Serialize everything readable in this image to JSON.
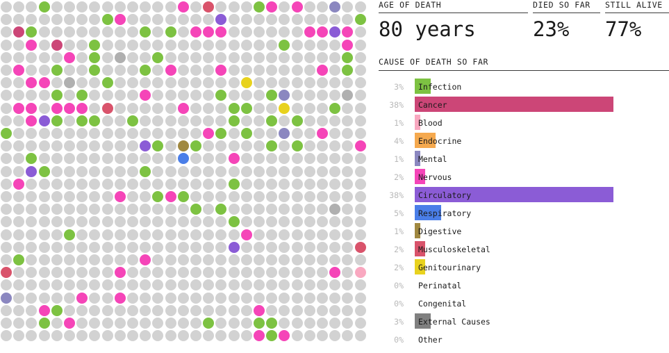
{
  "kpis": [
    {
      "id": "age-of-death",
      "label": "AGE OF DEATH",
      "value": "80 years"
    },
    {
      "id": "died-so-far",
      "label": "DIED SO FAR",
      "value": "23%"
    },
    {
      "id": "still-alive",
      "label": "STILL ALIVE",
      "value": "77%"
    }
  ],
  "cause_section": {
    "title": "CAUSE OF DEATH SO FAR"
  },
  "chart_data": {
    "type": "bar",
    "title": "CAUSE OF DEATH SO FAR",
    "xlabel": "",
    "ylabel": "",
    "orientation": "horizontal",
    "xlim": [
      0,
      100
    ],
    "grid": false,
    "legend": "none",
    "categories": [
      "Infection",
      "Cancer",
      "Blood",
      "Endocrine",
      "Mental",
      "Nervous",
      "Circulatory",
      "Respiratory",
      "Digestive",
      "Musculoskeletal",
      "Genitourinary",
      "Perinatal",
      "Congenital",
      "External Causes",
      "Other"
    ],
    "values": [
      3,
      38,
      1,
      4,
      1,
      2,
      38,
      5,
      1,
      2,
      2,
      0,
      0,
      3,
      0
    ],
    "value_labels": [
      "3%",
      "38%",
      "1%",
      "4%",
      "1%",
      "2%",
      "38%",
      "5%",
      "1%",
      "2%",
      "2%",
      "0%",
      "0%",
      "3%",
      "0%"
    ],
    "colors": [
      "#7DC242",
      "#CC4677",
      "#F9A8C0",
      "#F5A94E",
      "#8B87C0",
      "#F545B8",
      "#8B5CD6",
      "#4A7EE8",
      "#A08840",
      "#D9536B",
      "#E8D21E",
      "#B0B0B0",
      "#B0B0B0",
      "#808080",
      "#B0B0B0"
    ]
  },
  "grid": {
    "columns": 29,
    "rows": 27,
    "pitch": 18.2,
    "dot_size": 16,
    "alive_color": "#D2D2D2",
    "cells": [
      [
        0,
        0,
        0,
        1,
        0,
        0,
        0,
        0,
        0,
        0,
        0,
        0,
        0,
        0,
        6,
        0,
        10,
        0,
        0,
        0,
        1,
        6,
        0,
        6,
        0,
        0,
        5,
        0,
        0
      ],
      [
        0,
        0,
        0,
        0,
        0,
        0,
        0,
        0,
        1,
        6,
        0,
        0,
        0,
        0,
        0,
        0,
        0,
        7,
        0,
        0,
        0,
        0,
        0,
        0,
        0,
        0,
        0,
        0,
        1
      ],
      [
        0,
        2,
        1,
        0,
        0,
        0,
        0,
        0,
        0,
        0,
        0,
        1,
        0,
        1,
        0,
        6,
        6,
        6,
        0,
        0,
        0,
        0,
        0,
        0,
        6,
        6,
        7,
        6,
        0
      ],
      [
        0,
        0,
        6,
        0,
        2,
        0,
        0,
        1,
        0,
        0,
        0,
        0,
        0,
        0,
        0,
        0,
        0,
        0,
        0,
        0,
        0,
        0,
        1,
        0,
        0,
        0,
        0,
        6,
        0
      ],
      [
        0,
        0,
        0,
        0,
        0,
        6,
        0,
        1,
        0,
        13,
        0,
        0,
        1,
        0,
        0,
        0,
        0,
        0,
        0,
        0,
        0,
        0,
        0,
        0,
        0,
        0,
        0,
        1,
        0
      ],
      [
        0,
        6,
        0,
        0,
        1,
        0,
        0,
        1,
        0,
        0,
        0,
        1,
        0,
        6,
        0,
        0,
        0,
        6,
        0,
        0,
        0,
        0,
        0,
        0,
        0,
        6,
        0,
        1,
        0
      ],
      [
        0,
        0,
        6,
        6,
        0,
        13,
        0,
        0,
        1,
        0,
        0,
        0,
        0,
        0,
        0,
        0,
        0,
        0,
        0,
        11,
        0,
        0,
        0,
        0,
        0,
        0,
        0,
        0,
        0
      ],
      [
        0,
        0,
        0,
        0,
        1,
        0,
        1,
        0,
        0,
        0,
        0,
        6,
        0,
        0,
        0,
        0,
        0,
        1,
        0,
        0,
        0,
        1,
        5,
        0,
        0,
        0,
        0,
        13,
        0
      ],
      [
        0,
        6,
        6,
        0,
        6,
        6,
        6,
        0,
        10,
        0,
        0,
        0,
        0,
        0,
        6,
        0,
        0,
        0,
        1,
        1,
        0,
        0,
        11,
        0,
        0,
        0,
        1,
        0,
        0
      ],
      [
        0,
        0,
        6,
        7,
        1,
        0,
        1,
        1,
        0,
        0,
        1,
        0,
        0,
        0,
        0,
        0,
        0,
        0,
        1,
        0,
        0,
        1,
        0,
        1,
        0,
        0,
        0,
        0,
        0
      ],
      [
        1,
        0,
        0,
        0,
        0,
        0,
        0,
        0,
        0,
        0,
        0,
        0,
        0,
        0,
        0,
        0,
        6,
        1,
        0,
        1,
        0,
        0,
        5,
        0,
        0,
        6,
        0,
        0,
        0
      ],
      [
        0,
        0,
        0,
        0,
        0,
        0,
        0,
        0,
        0,
        0,
        0,
        7,
        1,
        0,
        9,
        1,
        0,
        0,
        0,
        0,
        0,
        1,
        0,
        1,
        0,
        0,
        0,
        0,
        6
      ],
      [
        0,
        0,
        1,
        0,
        0,
        0,
        0,
        0,
        0,
        0,
        0,
        0,
        0,
        0,
        8,
        0,
        0,
        0,
        6,
        0,
        0,
        0,
        0,
        0,
        0,
        0,
        0,
        0,
        0
      ],
      [
        0,
        0,
        7,
        1,
        0,
        0,
        0,
        0,
        0,
        0,
        0,
        1,
        0,
        0,
        0,
        0,
        0,
        0,
        0,
        0,
        0,
        0,
        0,
        0,
        0,
        0,
        0,
        0,
        0
      ],
      [
        0,
        6,
        0,
        0,
        0,
        0,
        0,
        0,
        0,
        0,
        0,
        0,
        0,
        0,
        0,
        0,
        0,
        0,
        1,
        0,
        0,
        0,
        0,
        0,
        0,
        0,
        0,
        0,
        0
      ],
      [
        0,
        0,
        0,
        0,
        0,
        0,
        0,
        0,
        0,
        6,
        0,
        0,
        1,
        6,
        1,
        0,
        0,
        0,
        0,
        0,
        0,
        0,
        0,
        0,
        0,
        0,
        0,
        0,
        0
      ],
      [
        0,
        0,
        0,
        0,
        0,
        0,
        0,
        0,
        0,
        0,
        0,
        0,
        0,
        0,
        0,
        1,
        0,
        1,
        0,
        0,
        0,
        0,
        0,
        0,
        0,
        0,
        13,
        0,
        0
      ],
      [
        0,
        0,
        0,
        0,
        0,
        0,
        0,
        0,
        0,
        0,
        0,
        0,
        0,
        0,
        0,
        0,
        0,
        0,
        1,
        0,
        0,
        0,
        0,
        0,
        0,
        0,
        0,
        0,
        0
      ],
      [
        0,
        0,
        0,
        0,
        0,
        1,
        0,
        0,
        0,
        0,
        0,
        0,
        0,
        0,
        0,
        0,
        0,
        0,
        0,
        6,
        0,
        0,
        0,
        0,
        0,
        0,
        0,
        0,
        0
      ],
      [
        0,
        0,
        0,
        0,
        0,
        0,
        0,
        0,
        0,
        0,
        0,
        0,
        0,
        0,
        0,
        0,
        0,
        0,
        7,
        0,
        0,
        0,
        0,
        0,
        0,
        0,
        0,
        0,
        10
      ],
      [
        0,
        1,
        0,
        0,
        0,
        0,
        0,
        0,
        0,
        0,
        0,
        6,
        0,
        0,
        0,
        0,
        0,
        0,
        0,
        0,
        0,
        0,
        0,
        0,
        0,
        0,
        0,
        0,
        0
      ],
      [
        10,
        0,
        0,
        0,
        0,
        0,
        0,
        0,
        0,
        6,
        0,
        0,
        0,
        0,
        0,
        0,
        0,
        0,
        0,
        0,
        0,
        0,
        0,
        0,
        0,
        0,
        6,
        0,
        3
      ],
      [
        0,
        0,
        0,
        0,
        0,
        0,
        0,
        0,
        0,
        0,
        0,
        0,
        0,
        0,
        0,
        0,
        0,
        0,
        0,
        0,
        0,
        0,
        0,
        0,
        0,
        0,
        0,
        0,
        0
      ],
      [
        5,
        0,
        0,
        0,
        0,
        0,
        6,
        0,
        0,
        6,
        0,
        0,
        0,
        0,
        0,
        0,
        0,
        0,
        0,
        0,
        0,
        0,
        0,
        0,
        0,
        0,
        0,
        0,
        0
      ],
      [
        0,
        0,
        0,
        6,
        1,
        0,
        0,
        0,
        0,
        0,
        0,
        0,
        0,
        0,
        0,
        0,
        0,
        0,
        0,
        0,
        6,
        0,
        0,
        0,
        0,
        0,
        0,
        0,
        0
      ],
      [
        0,
        0,
        0,
        1,
        0,
        6,
        0,
        0,
        0,
        0,
        0,
        0,
        0,
        0,
        0,
        0,
        1,
        0,
        0,
        0,
        1,
        1,
        0,
        0,
        0,
        0,
        0,
        0,
        0
      ],
      [
        0,
        0,
        0,
        0,
        0,
        0,
        0,
        0,
        0,
        0,
        0,
        0,
        0,
        0,
        0,
        0,
        0,
        0,
        0,
        0,
        6,
        1,
        6,
        0,
        0,
        0,
        0,
        0,
        0
      ]
    ]
  }
}
